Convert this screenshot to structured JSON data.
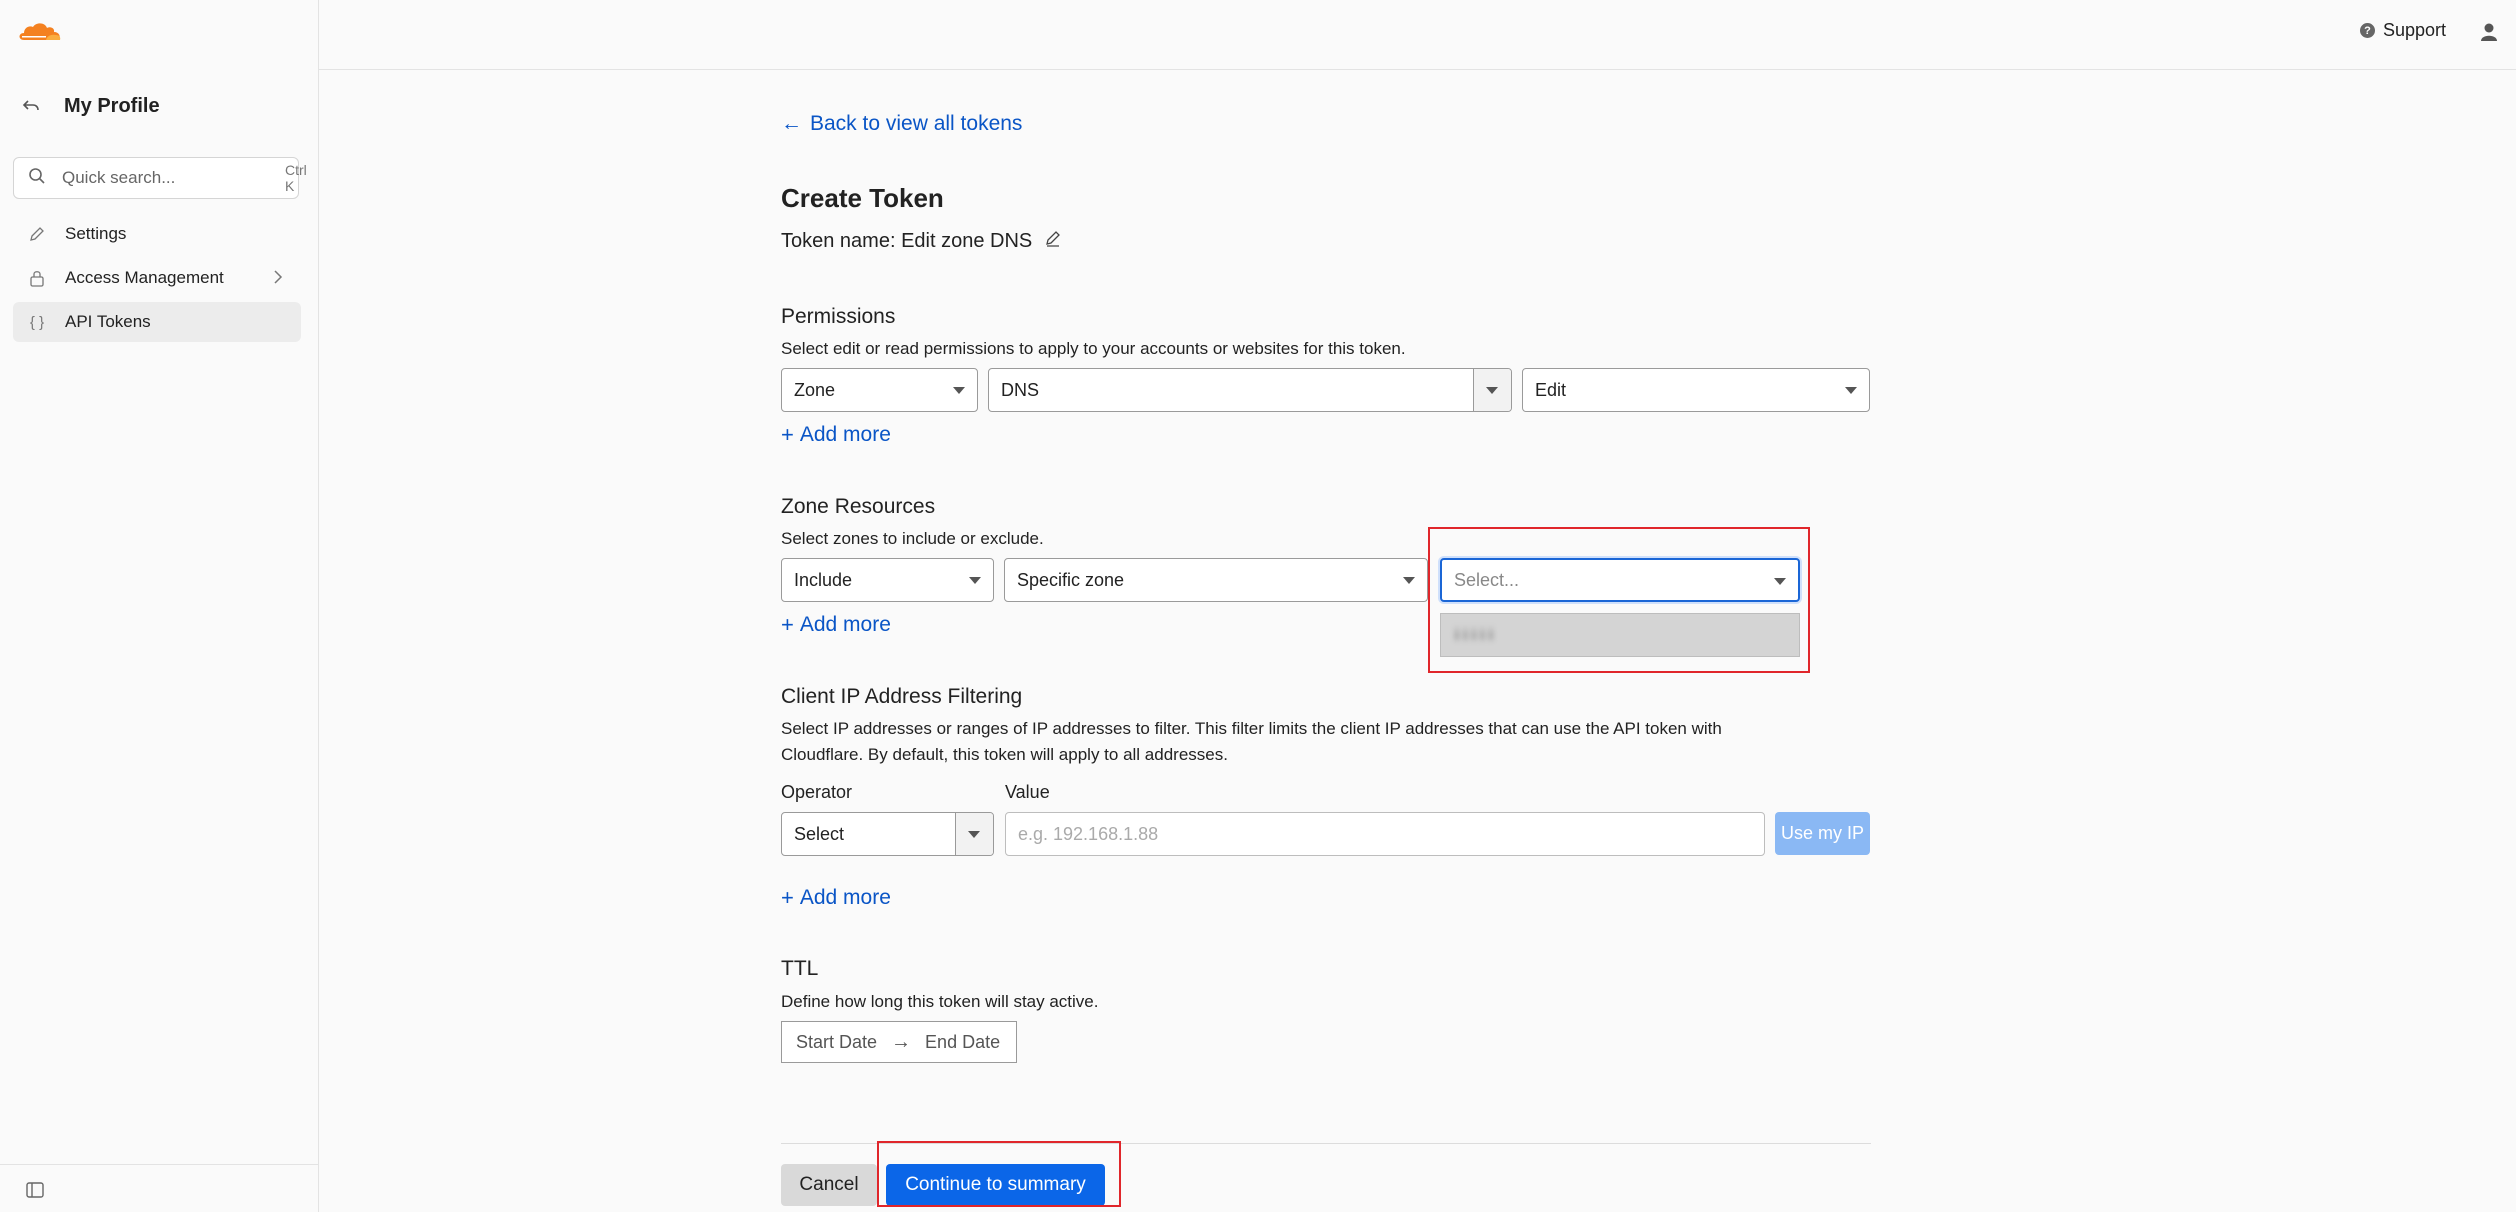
{
  "sidebar": {
    "title": "My Profile",
    "search": {
      "placeholder": "Quick search...",
      "shortcut": "Ctrl K"
    },
    "items": [
      {
        "label": "Settings"
      },
      {
        "label": "Access Management"
      },
      {
        "label": "API Tokens"
      }
    ]
  },
  "header": {
    "support_label": "Support"
  },
  "main": {
    "back_link": "Back to view all tokens",
    "title": "Create Token",
    "token_name": "Token name: Edit zone DNS",
    "permissions": {
      "title": "Permissions",
      "description": "Select edit or read permissions to apply to your accounts or websites for this token.",
      "scope": "Zone",
      "resource": "DNS",
      "level": "Edit",
      "add_more": "Add more"
    },
    "zone_resources": {
      "title": "Zone Resources",
      "description": "Select zones to include or exclude.",
      "mode": "Include",
      "type": "Specific zone",
      "zone_placeholder": "Select...",
      "dropdown_option": "i i i i i",
      "add_more": "Add more"
    },
    "ip_filtering": {
      "title": "Client IP Address Filtering",
      "description_line1": "Select IP addresses or ranges of IP addresses to filter. This filter limits the client IP addresses that can use the API token with",
      "description_line2": "Cloudflare. By default, this token will apply to all addresses.",
      "operator_label": "Operator",
      "value_label": "Value",
      "operator_value": "Select",
      "value_placeholder": "e.g. 192.168.1.88",
      "use_my_ip": "Use my IP",
      "add_more": "Add more"
    },
    "ttl": {
      "title": "TTL",
      "description": "Define how long this token will stay active.",
      "start_date": "Start Date",
      "end_date": "End Date"
    },
    "actions": {
      "cancel": "Cancel",
      "continue": "Continue to summary"
    }
  },
  "colors": {
    "brand_orange": "#f48120",
    "link_blue": "#0a55c6",
    "primary_button": "#0b66e8",
    "highlight_red": "#e0262b"
  }
}
